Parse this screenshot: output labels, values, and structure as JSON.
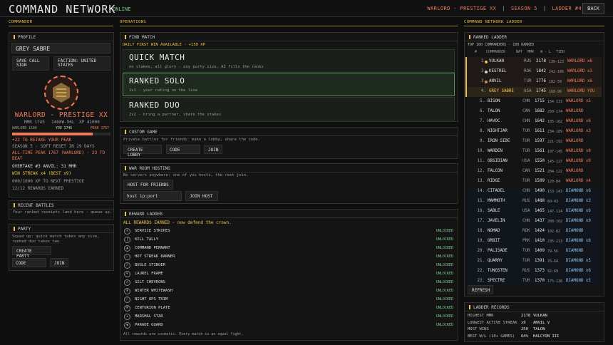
{
  "header": {
    "title": "COMMAND NETWORK",
    "status": "ONLINE",
    "rank_label": "WARLORD - PRESTIGE XX",
    "season": "SEASON 5",
    "ladder_pos": "LADDER #4",
    "back_label": "BACK",
    "sep": "|"
  },
  "sections": {
    "commander": "COMMANDER",
    "operations": "OPERATIONS",
    "ladder": "COMMAND NETWORK LADDER"
  },
  "profile": {
    "head": "PROFILE",
    "name": "GREY SABRE",
    "save_call_sign": "SAVE CALL SIGN",
    "faction": "FACTION: UNITED STATES",
    "rank": "WARLORD - PRESTIGE XX",
    "mmr": "MMR 1745",
    "record": "1468W-96L",
    "xp": "XP 41000",
    "bar_left": "WARLORD 1500",
    "bar_you": "YOU 1745",
    "bar_peak": "PEAK 1767",
    "bar_progress": 0.82,
    "retake": "+22 TO RETAKE YOUR PEAK",
    "season_reset": "SEASON 5 - SOFT RESET IN 29 DAYS",
    "all_time_peak": "ALL-TIME PEAK 1767  (WARLORD)  ·  23 TO BEAT",
    "overtake": "OVERTAKE #3 ANVIL: 31 MMR",
    "win_streak": "WIN STREAK x4   (BEST x9)",
    "xp_next": "000/1000 XP TO NEXT PRESTIGE",
    "rewards_earned": "12/12 REWARDS EARNED"
  },
  "recent_battles": {
    "head": "RECENT BATTLES",
    "text": "Your ranked receipts land here - queue up."
  },
  "party": {
    "head": "PARTY",
    "text": "Squad up: quick match takes any size, ranked duo takes two.",
    "create": "CREATE PARTY",
    "code_placeholder": "CODE",
    "join": "JOIN"
  },
  "find_match": {
    "head": "FIND MATCH",
    "daily": "DAILY FIRST WIN AVAILABLE  ·  +150 XP",
    "modes": [
      {
        "title": "QUICK MATCH",
        "desc": "no stakes, all glory - any party size, AI fills the ranks"
      },
      {
        "title": "RANKED SOLO",
        "desc": "1v1 - your rating on the line"
      },
      {
        "title": "RANKED DUO",
        "desc": "2v2 - bring a partner, share the stakes"
      }
    ]
  },
  "custom_game": {
    "head": "CUSTOM GAME",
    "text": "Private battles for friends: make a lobby, share the code.",
    "create": "CREATE LOBBY",
    "code_placeholder": "CODE",
    "join": "JOIN"
  },
  "war_room": {
    "head": "WAR ROOM HOSTING",
    "text": "No servers anywhere: one of you hosts, the rest join.",
    "host": "HOST FOR FRIENDS",
    "ip_placeholder": "host ip:port",
    "join_host": "JOIN HOST"
  },
  "reward_ladder": {
    "head": "REWARD LADDER",
    "earned": "ALL REWARDS EARNED - now defend the crown.",
    "footer": "All rewards are cosmetic. Every match is an equal fight.",
    "items": [
      {
        "name": "SERVICE STRIPES",
        "status": "UNLOCKED",
        "icon": "stripes-icon"
      },
      {
        "name": "KILL TALLY",
        "status": "UNLOCKED",
        "icon": "tally-icon"
      },
      {
        "name": "COMMAND PENNANT",
        "status": "UNLOCKED",
        "icon": "pennant-icon"
      },
      {
        "name": "HOT STREAK BANNER",
        "status": "UNLOCKED",
        "icon": "flame-icon"
      },
      {
        "name": "BUGLE STINGER",
        "status": "UNLOCKED",
        "icon": "bugle-icon"
      },
      {
        "name": "LAUREL FRAME",
        "status": "UNLOCKED",
        "icon": "laurel-icon"
      },
      {
        "name": "GILT CHEVRONS",
        "status": "UNLOCKED",
        "icon": "chevron-icon"
      },
      {
        "name": "WINTER WHITEWASH",
        "status": "UNLOCKED",
        "icon": "snowflake-icon"
      },
      {
        "name": "NIGHT OPS TRIM",
        "status": "UNLOCKED",
        "icon": "moon-icon"
      },
      {
        "name": "CENTURION PLATE",
        "status": "UNLOCKED",
        "icon": "helmet-icon"
      },
      {
        "name": "MARSHAL STAR",
        "status": "UNLOCKED",
        "icon": "star-icon"
      },
      {
        "name": "PARADE GUARD",
        "status": "UNLOCKED",
        "icon": "shield-icon"
      }
    ]
  },
  "ladder": {
    "head": "RANKED LADDER",
    "sub": "TOP 100 COMMANDERS · 100 RANKED",
    "cols": {
      "rank": "#",
      "commander": "COMMANDER",
      "nat": "NAT",
      "mmr": "MMR",
      "wl": "W - L",
      "tier": "TIER"
    },
    "refresh": "REFRESH",
    "rows": [
      {
        "rank": "1.",
        "name": "VULKAN",
        "nat": "RUS",
        "mmr": "2178",
        "wl": "136-123",
        "tier": "WARLORD x6",
        "kind": "top",
        "medal": "#f2c24e"
      },
      {
        "rank": "2.",
        "name": "KESTREL",
        "nat": "ROK",
        "mmr": "1842",
        "wl": "242-186",
        "tier": "WARLORD x3",
        "kind": "top",
        "medal": "#d8d8d8"
      },
      {
        "rank": "3.",
        "name": "ANVIL",
        "nat": "TUR",
        "mmr": "1776",
        "wl": "182-59",
        "tier": "WARLORD x6",
        "kind": "top",
        "medal": "#d08a4a"
      },
      {
        "rank": "4.",
        "name": "GREY SABRE",
        "nat": "USA",
        "mmr": "1745",
        "wl": "168-96",
        "tier": "WARLORD YOU",
        "kind": "you",
        "medal": ""
      },
      {
        "rank": "5.",
        "name": "BISON",
        "nat": "CHN",
        "mmr": "1715",
        "wl": "154-133",
        "tier": "WARLORD x5",
        "kind": "w",
        "medal": ""
      },
      {
        "rank": "6.",
        "name": "TALON",
        "nat": "CAN",
        "mmr": "1682",
        "wl": "250-174",
        "tier": "WARLORD",
        "kind": "w",
        "medal": ""
      },
      {
        "rank": "7.",
        "name": "HAVOC",
        "nat": "CHN",
        "mmr": "1642",
        "wl": "185-162",
        "tier": "WARLORD x6",
        "kind": "w",
        "medal": ""
      },
      {
        "rank": "8.",
        "name": "NIGHTJAR",
        "nat": "TUR",
        "mmr": "1611",
        "wl": "234-189",
        "tier": "WARLORD x3",
        "kind": "w",
        "medal": ""
      },
      {
        "rank": "9.",
        "name": "IRON SIDE",
        "nat": "TUR",
        "mmr": "1597",
        "wl": "221-192",
        "tier": "WARLORD",
        "kind": "w",
        "medal": ""
      },
      {
        "rank": "10.",
        "name": "WARDEN",
        "nat": "TUR",
        "mmr": "1561",
        "wl": "197-145",
        "tier": "WARLORD x8",
        "kind": "w",
        "medal": ""
      },
      {
        "rank": "11.",
        "name": "OBSIDIAN",
        "nat": "USA",
        "mmr": "1550",
        "wl": "145-127",
        "tier": "WARLORD x9",
        "kind": "w",
        "medal": ""
      },
      {
        "rank": "12.",
        "name": "FALCON",
        "nat": "CAN",
        "mmr": "1521",
        "wl": "204-122",
        "tier": "WARLORD",
        "kind": "w",
        "medal": ""
      },
      {
        "rank": "13.",
        "name": "RIDGE",
        "nat": "TUR",
        "mmr": "1509",
        "wl": "120-84",
        "tier": "WARLORD x4",
        "kind": "w",
        "medal": ""
      },
      {
        "rank": "14.",
        "name": "CITADEL",
        "nat": "CHN",
        "mmr": "1490",
        "wl": "153-143",
        "tier": "DIAMOND x6",
        "kind": "d",
        "medal": ""
      },
      {
        "rank": "15.",
        "name": "MAMMOTH",
        "nat": "RUS",
        "mmr": "1488",
        "wl": "60-43",
        "tier": "DIAMOND x3",
        "kind": "d",
        "medal": ""
      },
      {
        "rank": "16.",
        "name": "SABLE",
        "nat": "USA",
        "mmr": "1465",
        "wl": "147-114",
        "tier": "DIAMOND x6",
        "kind": "d",
        "medal": ""
      },
      {
        "rank": "17.",
        "name": "JAVELIN",
        "nat": "CHN",
        "mmr": "1437",
        "wl": "208-162",
        "tier": "DIAMOND x9",
        "kind": "d",
        "medal": ""
      },
      {
        "rank": "18.",
        "name": "NOMAD",
        "nat": "ROK",
        "mmr": "1424",
        "wl": "102-82",
        "tier": "DIAMOND",
        "kind": "d",
        "medal": ""
      },
      {
        "rank": "19.",
        "name": "ORBIT",
        "nat": "PRK",
        "mmr": "1410",
        "wl": "235-213",
        "tier": "DIAMOND x6",
        "kind": "d",
        "medal": ""
      },
      {
        "rank": "20.",
        "name": "PALISADE",
        "nat": "TUR",
        "mmr": "1409",
        "wl": "79-56",
        "tier": "DIAMOND",
        "kind": "d",
        "medal": ""
      },
      {
        "rank": "21.",
        "name": "QUARRY",
        "nat": "TUR",
        "mmr": "1391",
        "wl": "76-64",
        "tier": "DIAMOND x5",
        "kind": "d",
        "medal": ""
      },
      {
        "rank": "22.",
        "name": "TUNGSTEN",
        "nat": "RUS",
        "mmr": "1373",
        "wl": "92-69",
        "tier": "DIAMOND x6",
        "kind": "d",
        "medal": ""
      },
      {
        "rank": "23.",
        "name": "SPECTRE",
        "nat": "TUR",
        "mmr": "1370",
        "wl": "175-136",
        "tier": "DIAMOND x5",
        "kind": "d",
        "medal": ""
      }
    ]
  },
  "records": {
    "head": "LADDER RECORDS",
    "rows": [
      {
        "label": "HIGHEST MMR",
        "value": "2178",
        "who": "VULKAN"
      },
      {
        "label": "LONGEST ACTIVE STREAK",
        "value": "x9",
        "who": "ANVIL V"
      },
      {
        "label": "MOST WINS",
        "value": "250",
        "who": "TALON"
      },
      {
        "label": "BEST W/L (10+ GAMES)",
        "value": "64%",
        "who": "HALCYON III"
      }
    ]
  },
  "colors": {
    "accent": "#f2c24e",
    "warlord": "#f07a5a",
    "diamond": "#8cc0ee",
    "unlocked": "#7ec98c"
  }
}
